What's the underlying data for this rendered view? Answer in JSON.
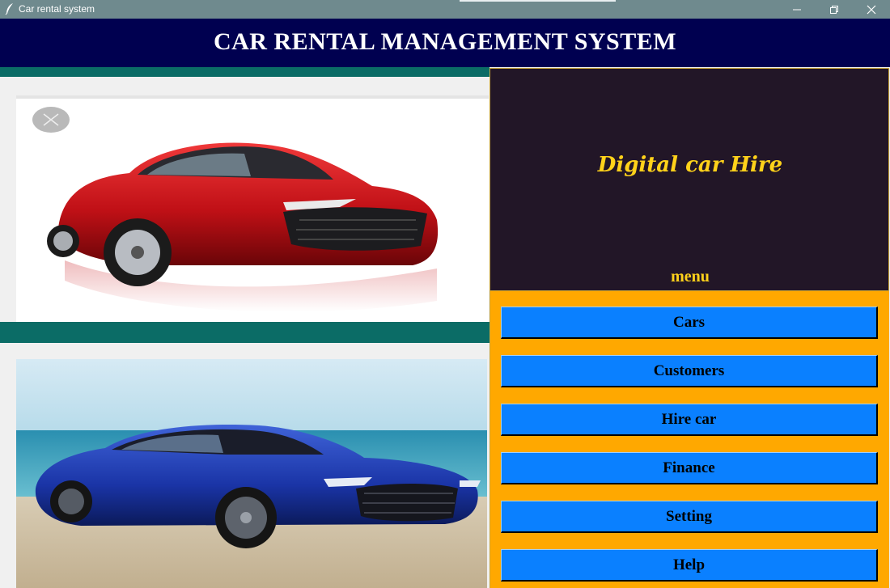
{
  "window": {
    "title": "Car rental system"
  },
  "header": {
    "title": "CAR RENTAL MANAGEMENT SYSTEM"
  },
  "panel": {
    "slogan": "Digital car Hire",
    "menu_label": "menu"
  },
  "menu": {
    "items": [
      "Cars",
      "Customers",
      "Hire car",
      "Finance",
      "Setting",
      "Help"
    ]
  },
  "colors": {
    "header_bg": "#000050",
    "teal": "#0b6c66",
    "panel_dark": "#221627",
    "panel_menu_bg": "#ffa800",
    "button_blue": "#0a80ff",
    "slogan_yellow": "#ffd21a"
  }
}
